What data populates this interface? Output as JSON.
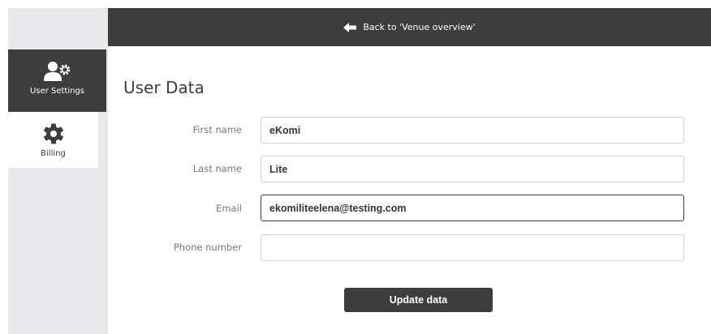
{
  "topbar": {
    "back_label": "Back to 'Venue overview'"
  },
  "sidebar": {
    "items": [
      {
        "label": "User Settings",
        "icon": "user-settings-icon",
        "active": true
      },
      {
        "label": "Billing",
        "icon": "gear-icon",
        "active": false
      }
    ]
  },
  "main": {
    "title": "User Data",
    "fields": [
      {
        "label": "First name",
        "value": "eKomi"
      },
      {
        "label": "Last name",
        "value": "Lite"
      },
      {
        "label": "Email",
        "value": "ekomiliteelena@testing.com"
      },
      {
        "label": "Phone number",
        "value": ""
      }
    ],
    "submit_label": "Update data"
  },
  "colors": {
    "dark": "#3d3d3d",
    "sidebar_bg": "#e8e8ec",
    "label": "#777777"
  }
}
